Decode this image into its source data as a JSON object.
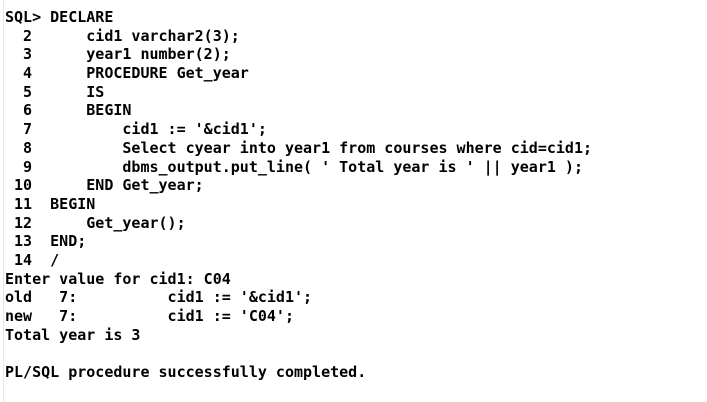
{
  "terminal": {
    "lines": [
      "SQL> DECLARE",
      "  2      cid1 varchar2(3);",
      "  3      year1 number(2);",
      "  4      PROCEDURE Get_year",
      "  5      IS",
      "  6      BEGIN",
      "  7          cid1 := '&cid1';",
      "  8          Select cyear into year1 from courses where cid=cid1;",
      "  9          dbms_output.put_line( ' Total year is ' || year1 );",
      " 10      END Get_year;",
      " 11  BEGIN",
      " 12      Get_year();",
      " 13  END;",
      " 14  /",
      "Enter value for cid1: C04",
      "old   7:          cid1 := '&cid1';",
      "new   7:          cid1 := 'C04';",
      "Total year is 3",
      "",
      "PL/SQL procedure successfully completed."
    ]
  }
}
